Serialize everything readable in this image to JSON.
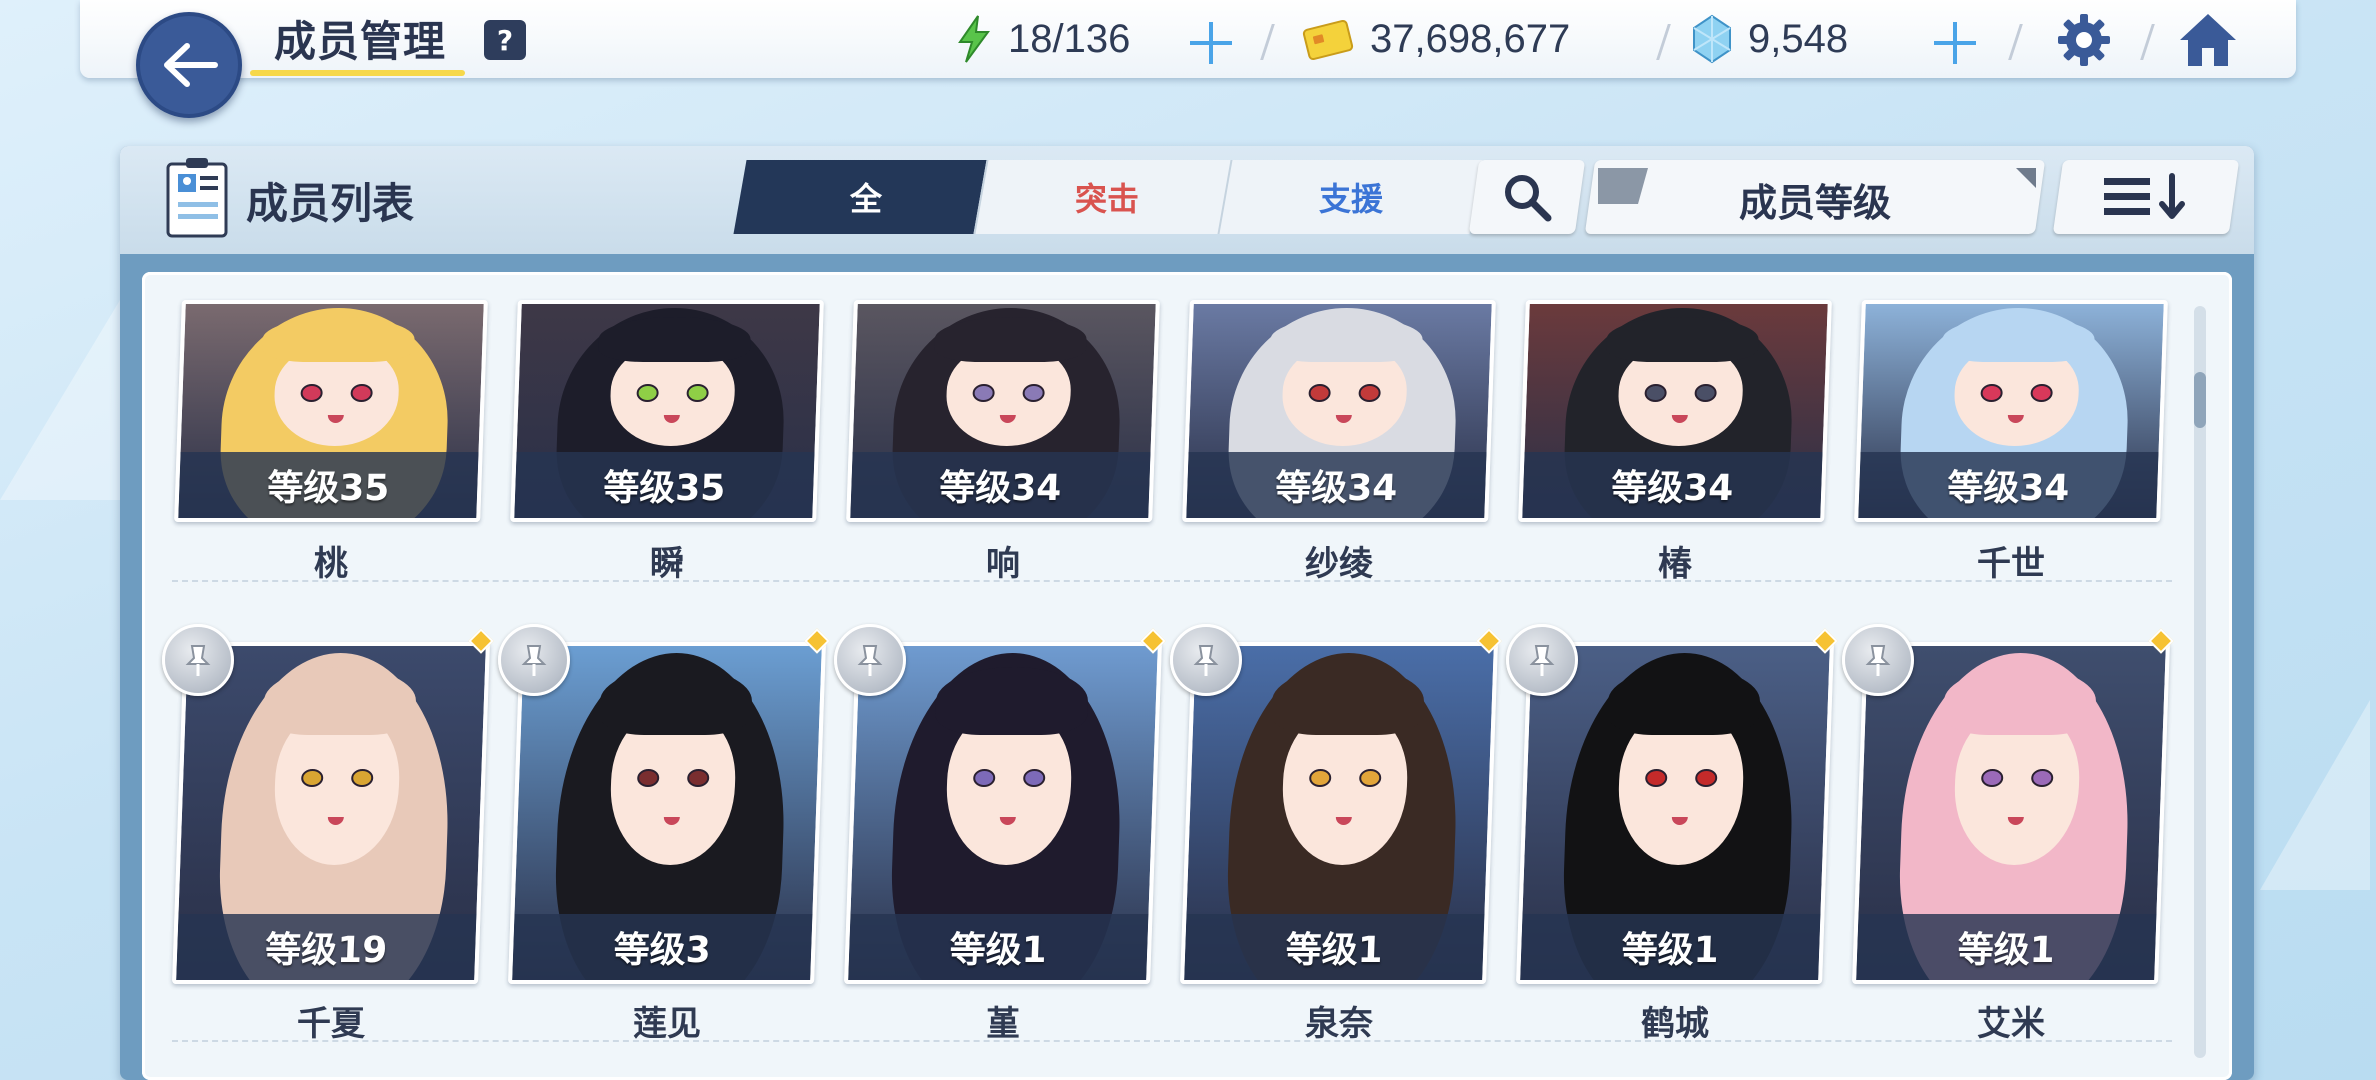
{
  "header": {
    "title": "成员管理",
    "help_label": "?",
    "ap": "18/136",
    "credits": "37,698,677",
    "gems": "9,548"
  },
  "panel": {
    "title": "成员列表",
    "tabs": [
      {
        "label": "全",
        "color": "#ffffff"
      },
      {
        "label": "突击",
        "color": "#d9534f"
      },
      {
        "label": "支援",
        "color": "#3b74d6"
      }
    ],
    "filter_label": "成员等级"
  },
  "members": [
    {
      "name": "桃",
      "level": "等级35",
      "hair": "#f3cb63",
      "eye": "#d23a5a",
      "bg": "#7a6a6f"
    },
    {
      "name": "瞬",
      "level": "等级35",
      "hair": "#1d1d2a",
      "eye": "#8fcf46",
      "bg": "#3e3847"
    },
    {
      "name": "响",
      "level": "等级34",
      "hair": "#27232e",
      "eye": "#8a7ab6",
      "bg": "#5a5660"
    },
    {
      "name": "纱绫",
      "level": "等级34",
      "hair": "#d9dbe2",
      "eye": "#c23a3a",
      "bg": "#6a7aa3"
    },
    {
      "name": "椿",
      "level": "等级34",
      "hair": "#22232a",
      "eye": "#4a4f66",
      "bg": "#6b3a3c"
    },
    {
      "name": "千世",
      "level": "等级34",
      "hair": "#b7d6f2",
      "eye": "#d8385a",
      "bg": "#8db2d9"
    },
    {
      "name": "千夏",
      "level": "等级19",
      "hair": "#e8c9b9",
      "eye": "#d9a532",
      "bg": "#3c4a6c"
    },
    {
      "name": "莲见",
      "level": "等级3",
      "hair": "#1a1a20",
      "eye": "#7a2e30",
      "bg": "#6b9ed2"
    },
    {
      "name": "堇",
      "level": "等级1",
      "hair": "#1f1b2d",
      "eye": "#7d6ab8",
      "bg": "#6f9bd0"
    },
    {
      "name": "泉奈",
      "level": "等级1",
      "hair": "#3a2a24",
      "eye": "#e2a53a",
      "bg": "#4a6ea8"
    },
    {
      "name": "鹤城",
      "level": "等级1",
      "hair": "#121214",
      "eye": "#c42a2a",
      "bg": "#4b5f86"
    },
    {
      "name": "艾米",
      "level": "等级1",
      "hair": "#f2b7c8",
      "eye": "#9b6ab8",
      "bg": "#3f4e6e"
    }
  ]
}
